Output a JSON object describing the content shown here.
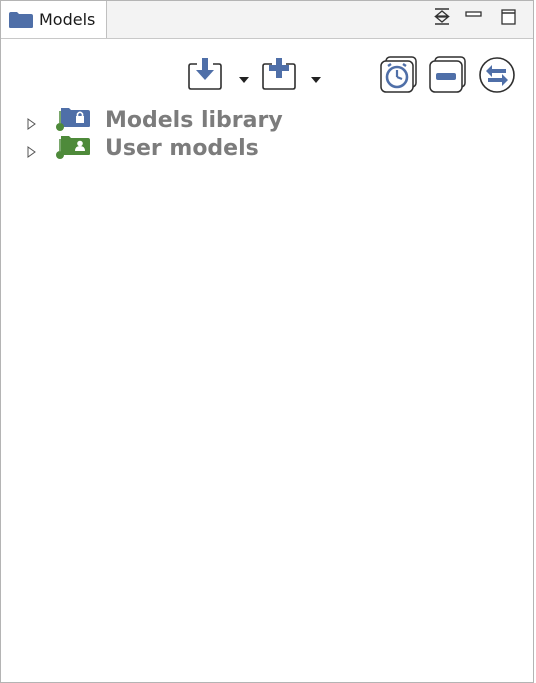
{
  "view": {
    "tab_label": "Models",
    "tab_icon": "folder-icon"
  },
  "view_controls": [
    {
      "name": "restore-view-icon"
    },
    {
      "name": "minimize-view-icon"
    },
    {
      "name": "maximize-view-icon"
    }
  ],
  "toolbar": [
    {
      "name": "import-model-button",
      "icon": "download-arrow-icon",
      "has_dropdown": true
    },
    {
      "name": "new-model-button",
      "icon": "plus-icon",
      "has_dropdown": true
    },
    {
      "name": "history-button",
      "icon": "clock-icon"
    },
    {
      "name": "collapse-all-button",
      "icon": "minus-icon"
    },
    {
      "name": "link-with-editor-button",
      "icon": "sync-arrows-icon"
    }
  ],
  "tree": {
    "items": [
      {
        "label": "Models library",
        "icon": "locked-folder-icon",
        "expanded": false
      },
      {
        "label": "User models",
        "icon": "user-folder-icon",
        "expanded": false
      }
    ]
  },
  "colors": {
    "accent_blue": "#4f6fa8",
    "accent_green": "#4e8a3a",
    "label_gray": "#7c7c7c"
  }
}
